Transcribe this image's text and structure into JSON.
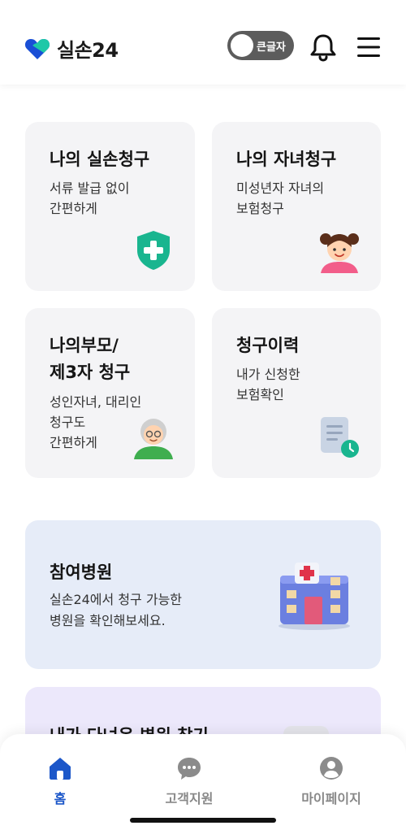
{
  "header": {
    "app_name": "실손24",
    "large_text_toggle": "큰글자",
    "colors": {
      "logo_blue": "#1a4fd6",
      "logo_teal": "#1ec8a8"
    }
  },
  "cards": [
    {
      "title": "나의 실손청구",
      "desc_lines": [
        "서류 발급 없이",
        "간편하게"
      ],
      "icon": "green-shield-plus-icon"
    },
    {
      "title": "나의 자녀청구",
      "desc_lines": [
        "미성년자 자녀의",
        "보험청구"
      ],
      "icon": "child-girl-icon"
    },
    {
      "title_lines": [
        "나의부모/",
        "제3자 청구"
      ],
      "desc_lines": [
        "성인자녀, 대리인",
        "청구도",
        "간편하게"
      ],
      "icon": "grandparent-icon"
    },
    {
      "title": "청구이력",
      "desc_lines": [
        "내가 신청한",
        "보험확인"
      ],
      "icon": "document-clock-icon"
    }
  ],
  "banners": [
    {
      "title": "참여병원",
      "desc_lines": [
        "실손24에서 청구 가능한",
        "병원을 확인해보세요."
      ],
      "icon": "hospital-building-icon",
      "bg": "#e6ecf8"
    },
    {
      "title": "내가 다녀온 병원 찾기",
      "bg": "#ece8fb"
    }
  ],
  "tabbar": {
    "tabs": [
      {
        "label": "홈",
        "icon": "home-icon",
        "active": true
      },
      {
        "label": "고객지원",
        "icon": "chat-bubble-icon",
        "active": false
      },
      {
        "label": "마이페이지",
        "icon": "user-profile-icon",
        "active": false
      }
    ],
    "active_color": "#1c57c9"
  }
}
